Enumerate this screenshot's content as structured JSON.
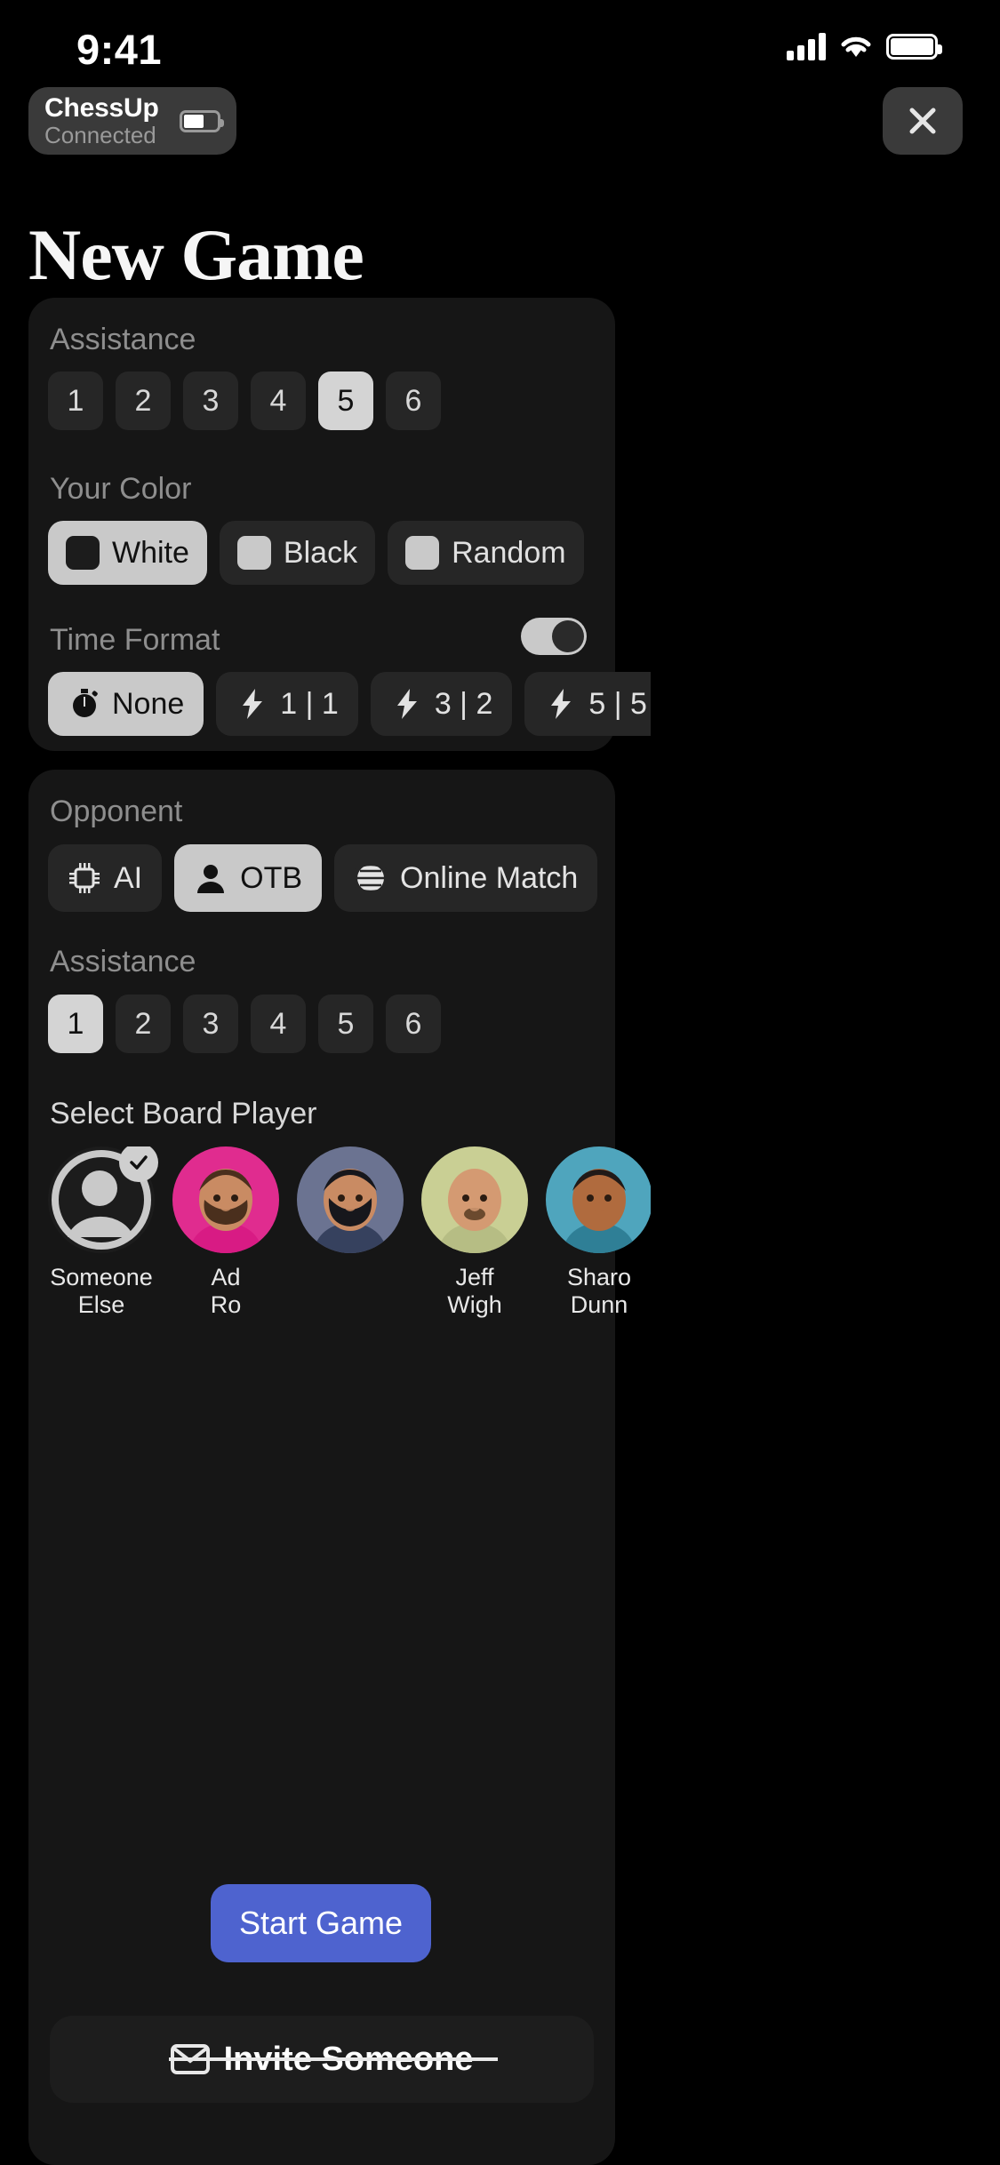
{
  "status_bar": {
    "time": "9:41",
    "icons": [
      "cellular-signal-icon",
      "wifi-icon",
      "battery-icon"
    ]
  },
  "device_pill": {
    "name": "ChessUp",
    "status": "Connected",
    "battery_icon": "battery-icon",
    "battery_level": 62
  },
  "close_button": {
    "icon": "close-icon",
    "label": ""
  },
  "page_title": "New Game",
  "settings_card": {
    "assistance": {
      "label": "Assistance",
      "options": [
        "1",
        "2",
        "3",
        "4",
        "5",
        "6"
      ],
      "selected": "5"
    },
    "your_color": {
      "label": "Your Color",
      "options": [
        {
          "label": "White",
          "swatch": "#1c1c1c",
          "selected": true
        },
        {
          "label": "Black",
          "swatch": "#c9c9c9",
          "selected": false
        },
        {
          "label": "Random",
          "swatch": "#c9c9c9",
          "selected": false
        }
      ]
    },
    "time_format": {
      "label": "Time Format",
      "toggle_on": true,
      "options": [
        {
          "label": "None",
          "icon": "stopwatch-icon",
          "selected": true
        },
        {
          "label": "1 | 1",
          "icon": "bolt-icon",
          "selected": false
        },
        {
          "label": "3 | 2",
          "icon": "bolt-icon",
          "selected": false
        },
        {
          "label": "5 | 5",
          "icon": "bolt-icon",
          "selected": false
        }
      ]
    }
  },
  "opponent_card": {
    "opponent": {
      "label": "Opponent",
      "options": [
        {
          "label": "AI",
          "icon": "cpu-chip-icon",
          "selected": false
        },
        {
          "label": "OTB",
          "icon": "person-icon",
          "selected": true
        },
        {
          "label": "Online Match",
          "icon": "globe-icon",
          "selected": false
        }
      ]
    },
    "assistance": {
      "label": "Assistance",
      "options": [
        "1",
        "2",
        "3",
        "4",
        "5",
        "6"
      ],
      "selected": "1"
    },
    "board_player": {
      "label": "Select Board Player",
      "players": [
        {
          "name_line1": "Someone",
          "name_line2": "Else",
          "selected": true,
          "avatar": "placeholder-person-icon",
          "bg": "#1c1c1c"
        },
        {
          "name_line1": "Ad",
          "name_line2": "Ro",
          "selected": false,
          "avatar": "avatar-curly-beard",
          "bg": "#e02c8f"
        },
        {
          "name_line1": "",
          "name_line2": "",
          "selected": false,
          "avatar": "avatar-dark-hair-beard",
          "bg": "#6b7391"
        },
        {
          "name_line1": "Jeff",
          "name_line2": "Wigh",
          "selected": false,
          "avatar": "avatar-bald-mustache",
          "bg": "#c9cf94"
        },
        {
          "name_line1": "Sharo",
          "name_line2": "Dunn",
          "selected": false,
          "avatar": "avatar-curly-woman",
          "bg": "#4fa5bd"
        }
      ]
    }
  },
  "start_button": {
    "label": "Start Game",
    "color": "#4e63cf"
  },
  "invite_button": {
    "label": "Invite Someone",
    "icon": "envelope-icon"
  }
}
